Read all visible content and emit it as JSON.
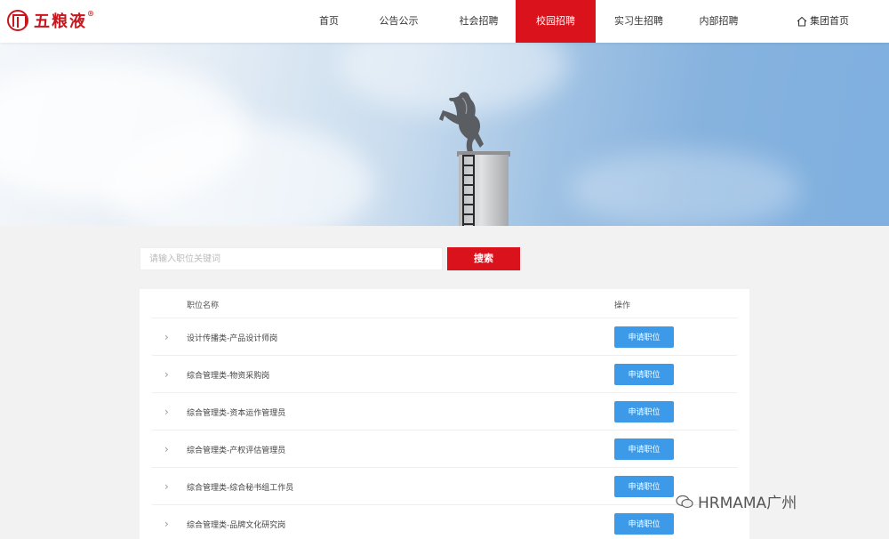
{
  "header": {
    "logo_text": "五粮液",
    "logo_reg": "®",
    "nav": [
      {
        "label": "首页",
        "active": false
      },
      {
        "label": "公告公示",
        "active": false
      },
      {
        "label": "社会招聘",
        "active": false
      },
      {
        "label": "校园招聘",
        "active": true
      },
      {
        "label": "实习生招聘",
        "active": false
      },
      {
        "label": "内部招聘",
        "active": false
      }
    ],
    "home_label": "集团首页",
    "accent_color": "#d9121c"
  },
  "search": {
    "placeholder": "请输入职位关键词",
    "button_label": "搜索"
  },
  "table": {
    "columns": [
      "职位名称",
      "操作"
    ],
    "rows": [
      {
        "name": "设计传播类-产品设计师岗",
        "action": "申请职位"
      },
      {
        "name": "综合管理类-物资采购岗",
        "action": "申请职位"
      },
      {
        "name": "综合管理类-资本运作管理员",
        "action": "申请职位"
      },
      {
        "name": "综合管理类-产权评估管理员",
        "action": "申请职位"
      },
      {
        "name": "综合管理类-综合秘书组工作员",
        "action": "申请职位"
      },
      {
        "name": "综合管理类-品牌文化研究岗",
        "action": "申请职位"
      }
    ]
  },
  "watermark": "HRMAMA广州"
}
